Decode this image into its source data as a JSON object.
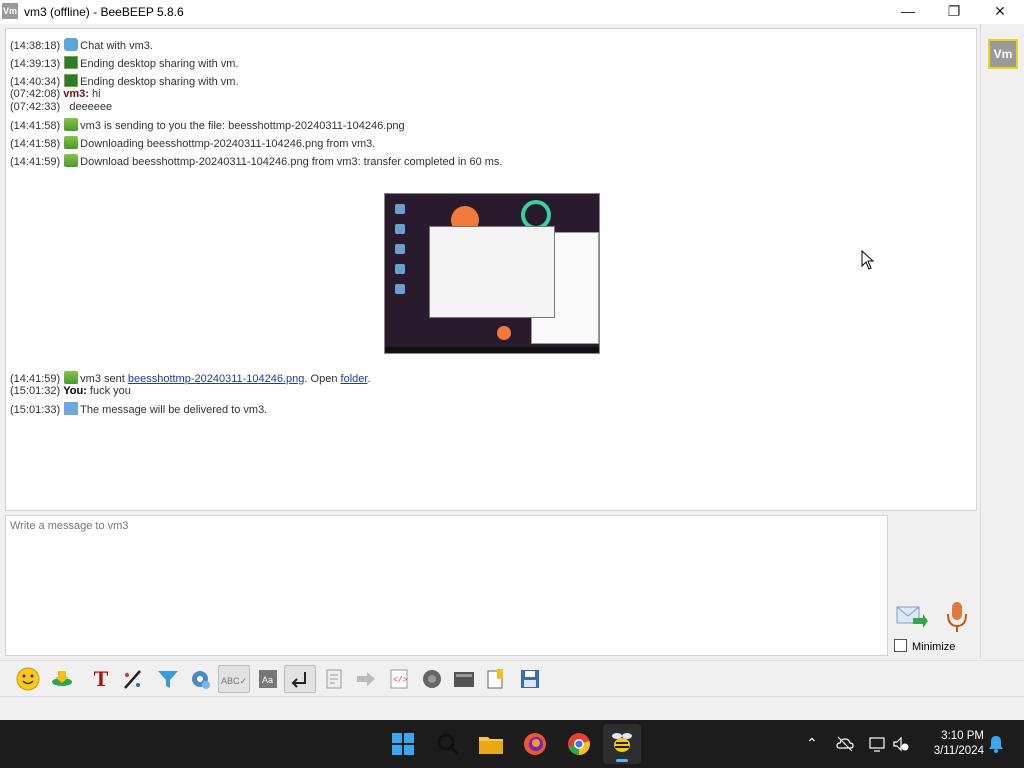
{
  "window": {
    "title": "vm3 (offline) - BeeBEEP 5.8.6",
    "app_icon_text": "Vm"
  },
  "chat": {
    "lines": [
      {
        "time": "(14:38:18)",
        "icon": "chat-bubble-icon",
        "text": "Chat with vm3."
      },
      {
        "time": "(14:39:13)",
        "icon": "desktop-share-icon",
        "text": "Ending desktop sharing with vm."
      },
      {
        "time": "(14:40:34)",
        "icon": "desktop-share-icon",
        "text": "Ending desktop sharing with vm."
      },
      {
        "time": "(07:42:08)",
        "sender": "vm3:",
        "text": "hi"
      },
      {
        "time": "(07:42:33)",
        "text": "deeeeee"
      },
      {
        "time": "(14:41:58)",
        "icon": "file-transfer-icon",
        "text": "vm3 is sending to you the file: beesshottmp-20240311-104246.png"
      },
      {
        "time": "(14:41:58)",
        "icon": "file-transfer-icon",
        "text": "Downloading beesshottmp-20240311-104246.png from vm3."
      },
      {
        "time": "(14:41:59)",
        "icon": "file-transfer-icon",
        "text": "Download beesshottmp-20240311-104246.png from vm3: transfer completed in 60 ms."
      }
    ],
    "sent_line": {
      "time": "(14:41:59)",
      "prefix": "vm3 sent",
      "file_link": "beesshottmp-20240311-104246.png",
      "middle": ". Open",
      "folder_link": "folder",
      "suffix": "."
    },
    "you_line": {
      "time": "(15:01:32)",
      "sender": "You:",
      "text": "fuck you"
    },
    "delivery_line": {
      "time": "(15:01:33)",
      "text": "The message will be delivered to vm3."
    }
  },
  "sidebar": {
    "avatar_text": "Vm"
  },
  "composer": {
    "placeholder": "Write a message to vm3",
    "minimize_label": "Minimize",
    "minimize_checked": false
  },
  "toolbar": {
    "buttons": [
      "emoticon",
      "send-file",
      "font",
      "color",
      "filter",
      "settings",
      "spellcheck",
      "word-complete",
      "return-send",
      "save-chat",
      "share-screen",
      "code",
      "record",
      "screenshot",
      "notes",
      "save"
    ],
    "active": [
      "spellcheck",
      "return-send"
    ]
  },
  "taskbar": {
    "time": "3:10 PM",
    "date": "3/11/2024"
  }
}
